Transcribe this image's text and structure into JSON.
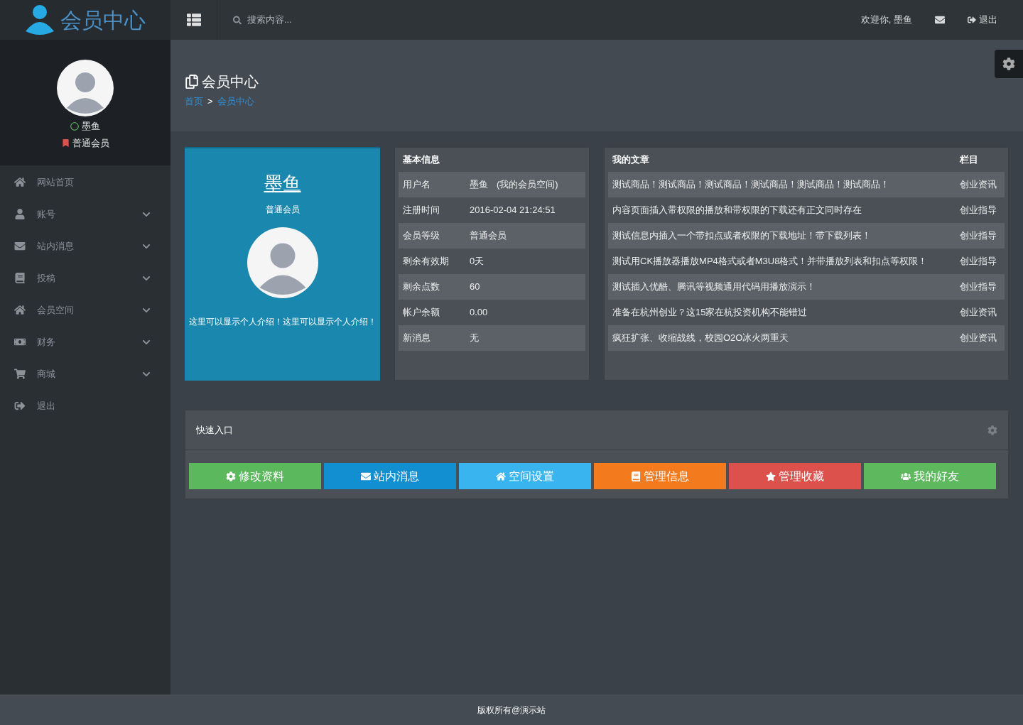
{
  "logo": {
    "title": "会员中心"
  },
  "search": {
    "placeholder": "搜索内容..."
  },
  "topbar": {
    "welcome": "欢迎你, 墨鱼",
    "logout": "退出"
  },
  "profile": {
    "name": "墨鱼",
    "level": "普通会员"
  },
  "sidebar": {
    "items": [
      {
        "label": "网站首页",
        "expandable": false
      },
      {
        "label": "账号",
        "expandable": true
      },
      {
        "label": "站内消息",
        "expandable": true
      },
      {
        "label": "投稿",
        "expandable": true
      },
      {
        "label": "会员空间",
        "expandable": true
      },
      {
        "label": "财务",
        "expandable": true
      },
      {
        "label": "商城",
        "expandable": true
      },
      {
        "label": "退出",
        "expandable": false
      }
    ]
  },
  "page": {
    "title": "会员中心",
    "breadcrumb": [
      "首页",
      "会员中心"
    ],
    "separator": ">"
  },
  "profile_card": {
    "name": "墨鱼",
    "level": "普通会员",
    "intro": "这里可以显示个人介绍！这里可以显示个人介绍！"
  },
  "basic_info": {
    "title": "基本信息",
    "rows": [
      {
        "label": "用户名",
        "value": "墨鱼",
        "link": "(我的会员空间)"
      },
      {
        "label": "注册时间",
        "value": "2016-02-04 21:24:51"
      },
      {
        "label": "会员等级",
        "value": "普通会员"
      },
      {
        "label": "剩余有效期",
        "value": "0天"
      },
      {
        "label": "剩余点数",
        "value": "60"
      },
      {
        "label": "帐户余额",
        "value": "0.00"
      },
      {
        "label": "新消息",
        "value": "无"
      }
    ]
  },
  "articles": {
    "columns": [
      "我的文章",
      "栏目"
    ],
    "rows": [
      [
        "测试商品！测试商品！测试商品！测试商品！测试商品！测试商品！",
        "创业资讯"
      ],
      [
        "内容页面插入带权限的播放和带权限的下载还有正文同时存在",
        "创业指导"
      ],
      [
        "测试信息内插入一个带扣点或者权限的下载地址！带下载列表！",
        "创业指导"
      ],
      [
        "测试用CK播放器播放MP4格式或者M3U8格式！并带播放列表和扣点等权限！",
        "创业指导"
      ],
      [
        "测试插入优酷、腾讯等视频通用代码用播放演示！",
        "创业指导"
      ],
      [
        "准备在杭州创业？这15家在杭投资机构不能错过",
        "创业资讯"
      ],
      [
        "疯狂扩张、收缩战线，校园O2O冰火两重天",
        "创业资讯"
      ]
    ]
  },
  "quick": {
    "title": "快速入口",
    "buttons": [
      {
        "label": "修改资料",
        "color": "#5cb85c"
      },
      {
        "label": "站内消息",
        "color": "#118fd1"
      },
      {
        "label": "空间设置",
        "color": "#3ab4ee"
      },
      {
        "label": "管理信息",
        "color": "#f37b1d"
      },
      {
        "label": "管理收藏",
        "color": "#dd514c"
      },
      {
        "label": "我的好友",
        "color": "#5eb95e"
      }
    ]
  },
  "footer": "版权所有@演示站"
}
